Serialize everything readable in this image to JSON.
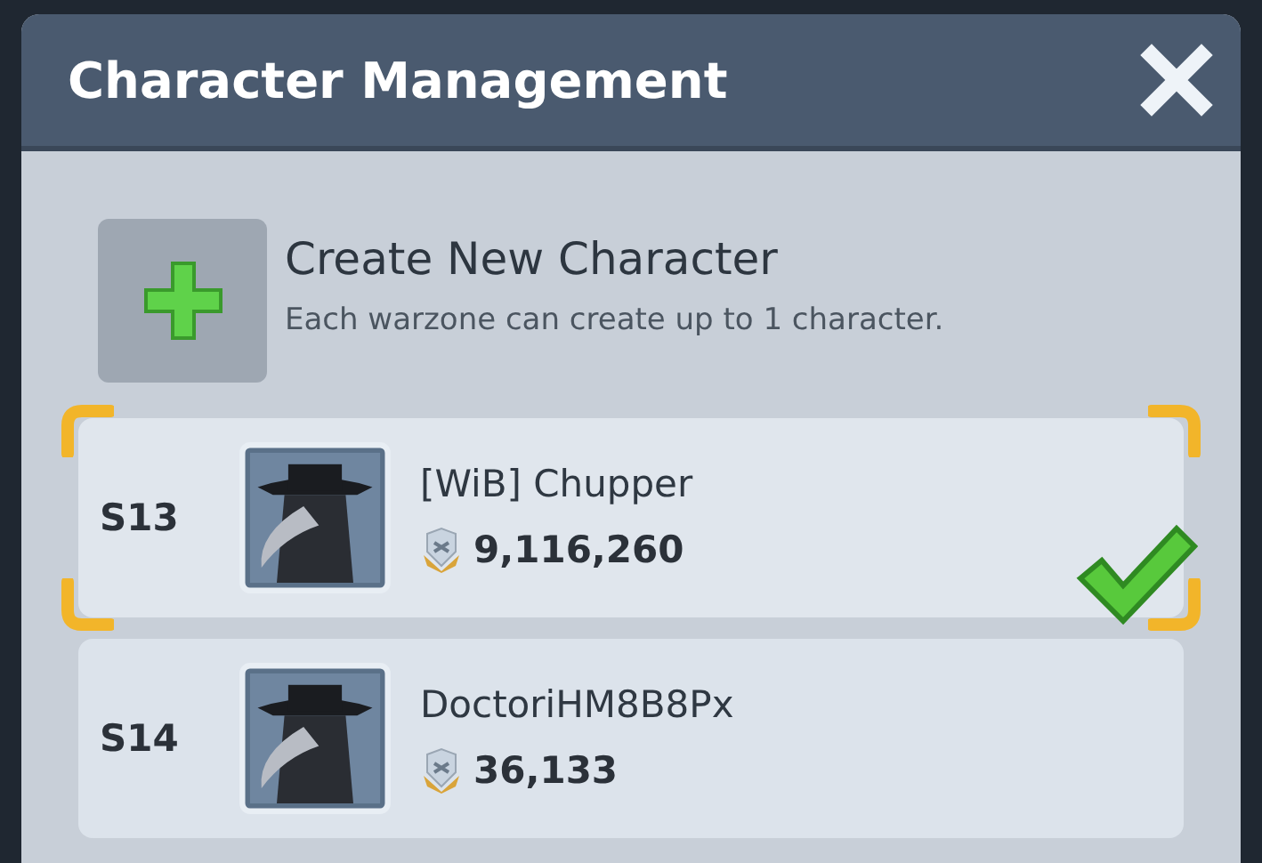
{
  "window": {
    "title": "Character Management"
  },
  "create": {
    "title": "Create New Character",
    "note": "Each warzone can create up to 1 character."
  },
  "characters": [
    {
      "server": "S13",
      "name": "[WiB] Chupper",
      "power": "9,116,260",
      "selected": true
    },
    {
      "server": "S14",
      "name": "DoctoriHM8B8Px",
      "power": "36,133",
      "selected": false
    }
  ]
}
